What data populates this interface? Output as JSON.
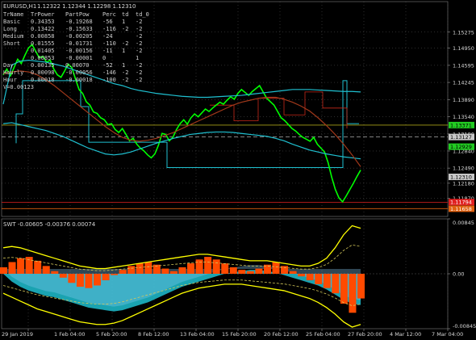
{
  "header": {
    "symbol": "EURUSD,H1",
    "ohlc": "1.12322 1.12344 1.12298 1.12310"
  },
  "info_table": {
    "columns": [
      "TrName",
      "TrPower",
      "PartPow",
      "Perc",
      "td",
      "td_0"
    ],
    "rows": [
      [
        "Basic",
        "0.34353",
        "-0.19268",
        "-56",
        "1",
        "-2"
      ],
      [
        "Long",
        "0.13422",
        "-0.15633",
        "-116",
        "-2",
        "-2"
      ],
      [
        "Medium",
        "0.00858",
        "-0.00205",
        "-24",
        "",
        "-2"
      ],
      [
        "Short",
        "0.01555",
        "-0.01731",
        "-110",
        "-2",
        "-2"
      ],
      [
        "",
        "0.01405",
        "-0.00156",
        "-11",
        "1",
        "-2"
      ],
      [
        "",
        "0.00853",
        "-0.00001",
        "0",
        "",
        "1"
      ],
      [
        "Day",
        "0.00135",
        "0.00070",
        "-52",
        "1",
        "-2"
      ],
      [
        "Hourly",
        "0.00098",
        "-0.00056",
        "-146",
        "-2",
        "-2"
      ],
      [
        "Hour",
        "0.00018",
        "-0.00018",
        "-100",
        "-2",
        "-2"
      ]
    ],
    "footer": "V=0.00123"
  },
  "colors": {
    "background": "#000000",
    "grid": "#5a5a5a",
    "price": "#00ff00",
    "cyan": "#1fc0d0",
    "brown": "#a0381a",
    "red_step": "#c8281a",
    "yellow": "#ffff00",
    "orange": "#ff4a00",
    "light_blue": "#87c8f0",
    "pale_yellow": "#d4c85a",
    "price_tag_green": "#22cc22",
    "price_tag_red": "#e02020",
    "price_tag_gray": "#c8c8c8",
    "price_tag_orange": "#e06010"
  },
  "chart_data": [
    {
      "type": "line",
      "name": "EURUSD,H1 price",
      "title": "EURUSD,H1",
      "ylim": [
        1.115,
        1.159
      ],
      "y_ticks": [
        "1.15275",
        "1.14950",
        "1.14595",
        "1.14245",
        "1.13890",
        "1.13540",
        "1.13190",
        "1.12840",
        "1.12490",
        "1.12180",
        "1.11870"
      ],
      "x_ticks": [
        "29 Jan 2019",
        "1 Feb 04:00",
        "5 Feb 20:00",
        "8 Feb 12:00",
        "13 Feb 04:00",
        "15 Feb 20:00",
        "20 Feb 12:00",
        "25 Feb 04:00",
        "27 Feb 20:00",
        "4 Mar 12:00",
        "7 Mar 04:00"
      ],
      "markers": [
        {
          "label": "1.13371",
          "value": 1.13371,
          "kind": "green"
        },
        {
          "label": "1.13127",
          "value": 1.13127,
          "kind": "gray"
        },
        {
          "label": "1.12929",
          "value": 1.12929,
          "kind": "green"
        },
        {
          "label": "1.12310",
          "value": 1.1231,
          "kind": "gray"
        },
        {
          "label": "1.11794",
          "value": 1.11794,
          "kind": "red"
        },
        {
          "label": "1.11658",
          "value": 1.11658,
          "kind": "orange"
        }
      ],
      "series": [
        {
          "role": "price",
          "values": [
            1.144,
            1.1452,
            1.1438,
            1.1455,
            1.1472,
            1.1463,
            1.148,
            1.1495,
            1.1502,
            1.1488,
            1.1475,
            1.1478,
            1.1466,
            1.147,
            1.1452,
            1.144,
            1.1435,
            1.1448,
            1.1462,
            1.1455,
            1.1432,
            1.141,
            1.1402,
            1.1385,
            1.1378,
            1.1364,
            1.1361,
            1.1352,
            1.1348,
            1.1338,
            1.134,
            1.1328,
            1.1322,
            1.133,
            1.1318,
            1.1305,
            1.131,
            1.1298,
            1.129,
            1.1284,
            1.1276,
            1.127,
            1.1278,
            1.1296,
            1.132,
            1.1318,
            1.1305,
            1.1312,
            1.1328,
            1.134,
            1.1348,
            1.1339,
            1.1352,
            1.136,
            1.1354,
            1.1362,
            1.137,
            1.1365,
            1.1372,
            1.1378,
            1.1384,
            1.138,
            1.1388,
            1.1395,
            1.139,
            1.1402,
            1.141,
            1.1404,
            1.1398,
            1.1406,
            1.1412,
            1.1418,
            1.1405,
            1.1392,
            1.1385,
            1.1378,
            1.1365,
            1.1352,
            1.1346,
            1.1338,
            1.133,
            1.1325,
            1.1318,
            1.1312,
            1.1308,
            1.1304,
            1.1312,
            1.1298,
            1.129,
            1.1282,
            1.126,
            1.123,
            1.1205,
            1.1188,
            1.118,
            1.1192,
            1.1205,
            1.1218,
            1.1232,
            1.1245
          ]
        },
        {
          "role": "cyan_upper",
          "values": [
            1.138,
            1.146,
            1.1468,
            1.147,
            1.1468,
            1.1466,
            1.1462,
            1.1458,
            1.1452,
            1.1446,
            1.144,
            1.1434,
            1.1428,
            1.1422,
            1.1418,
            1.1412,
            1.1408,
            1.1405,
            1.1402,
            1.14,
            1.1398,
            1.1396,
            1.1395,
            1.1394,
            1.1394,
            1.1395,
            1.1396,
            1.1397,
            1.1398,
            1.14,
            1.1402,
            1.1404,
            1.1406,
            1.1408,
            1.141,
            1.141,
            1.141,
            1.1409,
            1.1408,
            1.1407,
            1.1406,
            1.1406,
            1.1405
          ]
        },
        {
          "role": "cyan_lower",
          "values": [
            1.134,
            1.1342,
            1.1338,
            1.1334,
            1.133,
            1.1326,
            1.132,
            1.1314,
            1.1306,
            1.1298,
            1.129,
            1.1284,
            1.1278,
            1.1276,
            1.1278,
            1.1282,
            1.1288,
            1.1294,
            1.13,
            1.1305,
            1.131,
            1.1314,
            1.1318,
            1.132,
            1.1322,
            1.1323,
            1.1323,
            1.1322,
            1.132,
            1.1318,
            1.1316,
            1.1314,
            1.131,
            1.1305,
            1.1298,
            1.1292,
            1.1286,
            1.1282,
            1.1278,
            1.1275,
            1.1272,
            1.127,
            1.1268
          ]
        },
        {
          "role": "brown_ma",
          "values": [
            1.1442,
            1.1446,
            1.1448,
            1.1446,
            1.144,
            1.143,
            1.1418,
            1.1404,
            1.139,
            1.1376,
            1.1362,
            1.1348,
            1.1334,
            1.1322,
            1.1312,
            1.1306,
            1.1304,
            1.1306,
            1.131,
            1.1316,
            1.1322,
            1.133,
            1.1338,
            1.1346,
            1.1354,
            1.1362,
            1.137,
            1.1378,
            1.1384,
            1.1388,
            1.1392,
            1.1394,
            1.1394,
            1.139,
            1.1384,
            1.1376,
            1.1366,
            1.1352,
            1.1336,
            1.1318,
            1.1298,
            1.1276,
            1.1252
          ]
        }
      ]
    },
    {
      "type": "area",
      "name": "SWT",
      "title": "SWT -0.00605 -0.00376 0.00074",
      "ylim": [
        -0.00845,
        0.00845
      ],
      "y_ticks": [
        "0.00845",
        "0.00",
        "-0.00845"
      ],
      "series": [
        {
          "role": "cyan_area",
          "values": [
            0.0,
            -0.0012,
            -0.002,
            -0.0026,
            -0.003,
            -0.0034,
            -0.0036,
            -0.004,
            -0.0044,
            -0.0048,
            -0.0052,
            -0.0054,
            -0.0056,
            -0.0058,
            -0.0056,
            -0.0052,
            -0.0048,
            -0.0044,
            -0.0038,
            -0.0032,
            -0.0026,
            -0.002,
            -0.0016,
            -0.0012,
            -0.0008,
            -0.0004,
            0.0,
            0.0002,
            0.0004,
            0.0006,
            0.0006,
            0.0004,
            0.0002,
            -0.0002,
            -0.0006,
            -0.001,
            -0.0014,
            -0.0018,
            -0.0024,
            -0.0032,
            -0.004,
            -0.0046,
            -0.0048
          ]
        },
        {
          "role": "orange_bars",
          "values": [
            0.001,
            0.0018,
            0.0024,
            0.0026,
            0.002,
            0.0012,
            0.0004,
            -0.0006,
            -0.0014,
            -0.002,
            -0.0022,
            -0.0018,
            -0.001,
            -0.0002,
            0.0006,
            0.0012,
            0.0016,
            0.0018,
            0.0014,
            0.0008,
            0.0004,
            0.001,
            0.0016,
            0.0022,
            0.0026,
            0.0022,
            0.0016,
            0.001,
            0.0006,
            0.0004,
            0.0008,
            0.0014,
            0.0018,
            0.0012,
            0.0004,
            -0.0004,
            -0.001,
            -0.0016,
            -0.0022,
            -0.003,
            -0.0046,
            -0.006,
            -0.0038
          ]
        },
        {
          "role": "yellow_band_upper",
          "values": [
            0.004,
            0.0042,
            0.004,
            0.0036,
            0.0032,
            0.0028,
            0.0024,
            0.002,
            0.0016,
            0.0012,
            0.001,
            0.0008,
            0.0008,
            0.001,
            0.0012,
            0.0014,
            0.0016,
            0.0018,
            0.002,
            0.0022,
            0.0024,
            0.0026,
            0.0028,
            0.003,
            0.003,
            0.0028,
            0.0026,
            0.0024,
            0.0022,
            0.002,
            0.002,
            0.002,
            0.0018,
            0.0016,
            0.0014,
            0.0012,
            0.0012,
            0.0016,
            0.0024,
            0.004,
            0.006,
            0.0074,
            0.007
          ]
        },
        {
          "role": "yellow_band_lower",
          "values": [
            -0.003,
            -0.0036,
            -0.0042,
            -0.0048,
            -0.0054,
            -0.0058,
            -0.0062,
            -0.0066,
            -0.007,
            -0.0074,
            -0.0076,
            -0.0078,
            -0.0078,
            -0.0076,
            -0.0072,
            -0.0066,
            -0.006,
            -0.0054,
            -0.0048,
            -0.0042,
            -0.0036,
            -0.003,
            -0.0026,
            -0.0022,
            -0.002,
            -0.0018,
            -0.0016,
            -0.0016,
            -0.0016,
            -0.0018,
            -0.002,
            -0.0022,
            -0.0024,
            -0.0026,
            -0.003,
            -0.0034,
            -0.0038,
            -0.0044,
            -0.0052,
            -0.0062,
            -0.0074,
            -0.0082,
            -0.0078
          ]
        }
      ]
    }
  ]
}
